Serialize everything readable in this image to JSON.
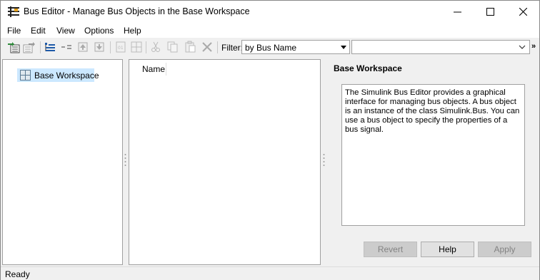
{
  "window": {
    "title": "Bus Editor - Manage Bus Objects in the Base Workspace"
  },
  "menu": {
    "items": [
      "File",
      "Edit",
      "View",
      "Options",
      "Help"
    ]
  },
  "toolbar": {
    "filter_label": "Filter:",
    "filter_mode": "by Bus Name",
    "filter_text": "",
    "overflow": "»"
  },
  "tree": {
    "items": [
      {
        "label": "Base Workspace",
        "selected": true,
        "icon": "workspace-grid-icon"
      }
    ]
  },
  "list": {
    "columns": [
      "Name"
    ],
    "rows": []
  },
  "details": {
    "title": "Base Workspace",
    "description": "The Simulink Bus Editor provides a graphical interface for managing bus objects. A bus object is an instance of the class Simulink.Bus. You can use a bus object to specify the properties of a bus signal."
  },
  "buttons": {
    "revert": "Revert",
    "help": "Help",
    "apply": "Apply"
  },
  "status": {
    "text": "Ready"
  },
  "colors": {
    "selection": "#cce8ff",
    "accent_blue": "#1e5aa8",
    "accent_green": "#2e8b3a"
  }
}
